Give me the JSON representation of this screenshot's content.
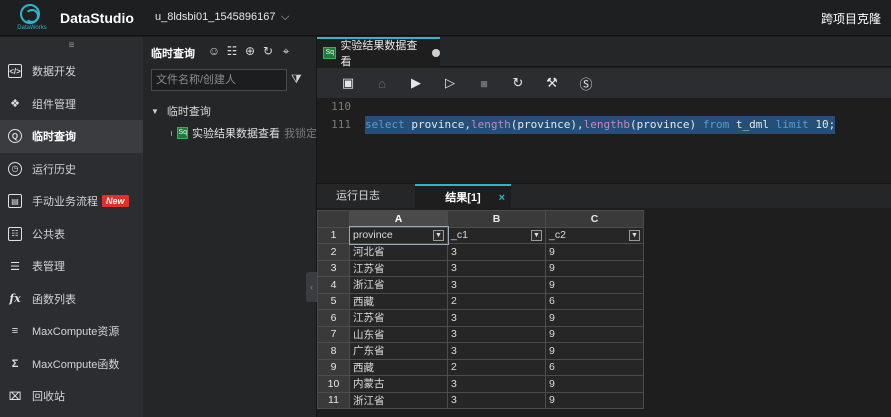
{
  "app": {
    "logo_text": "DataWorks",
    "title": "DataStudio",
    "project": "u_8ldsbi01_1545896167",
    "top_right": "跨项目克隆"
  },
  "nav": {
    "handle": "≡",
    "items": [
      {
        "label": "数据开发",
        "icon": "code-icon"
      },
      {
        "label": "组件管理",
        "icon": "puzzle-icon"
      },
      {
        "label": "临时查询",
        "icon": "search-icon",
        "active": true
      },
      {
        "label": "运行历史",
        "icon": "clock-icon"
      },
      {
        "label": "手动业务流程",
        "icon": "workflow-icon",
        "badge": "New"
      },
      {
        "label": "公共表",
        "icon": "table-icon"
      },
      {
        "label": "表管理",
        "icon": "list-icon"
      },
      {
        "label": "函数列表",
        "icon": "function-icon"
      },
      {
        "label": "MaxCompute资源",
        "icon": "resource-icon"
      },
      {
        "label": "MaxCompute函数",
        "icon": "sigma-icon"
      },
      {
        "label": "回收站",
        "icon": "trash-icon"
      }
    ]
  },
  "filepanel": {
    "title": "临时查询",
    "search_placeholder": "文件名称/创建人",
    "folder": "临时查询",
    "file_badge": "Sq",
    "file_name": "实验结果数据查看",
    "file_lock": "我锁定"
  },
  "editor": {
    "tab_badge": "Sq",
    "tab_title": "实验结果数据查看",
    "lines": [
      {
        "num": "110"
      },
      {
        "num": "111"
      }
    ],
    "sql": {
      "select": "select",
      "col1": " province,",
      "fn1": "length",
      "arg1": "(province),",
      "fn2": "lengthb",
      "arg2": "(province) ",
      "from": "from",
      "table": " t_dml ",
      "limit": "limit",
      "n": " 10;"
    }
  },
  "result": {
    "tabs": [
      {
        "label": "运行日志"
      },
      {
        "label": "结果[1]",
        "active": true
      }
    ],
    "close": "×",
    "columns": [
      "A",
      "B",
      "C"
    ],
    "headers": [
      "province",
      "_c1",
      "_c2"
    ],
    "rows": [
      [
        "河北省",
        "3",
        "9"
      ],
      [
        "江苏省",
        "3",
        "9"
      ],
      [
        "浙江省",
        "3",
        "9"
      ],
      [
        "西藏",
        "2",
        "6"
      ],
      [
        "江苏省",
        "3",
        "9"
      ],
      [
        "山东省",
        "3",
        "9"
      ],
      [
        "广东省",
        "3",
        "9"
      ],
      [
        "西藏",
        "2",
        "6"
      ],
      [
        "内蒙古",
        "3",
        "9"
      ],
      [
        "浙江省",
        "3",
        "9"
      ]
    ]
  }
}
